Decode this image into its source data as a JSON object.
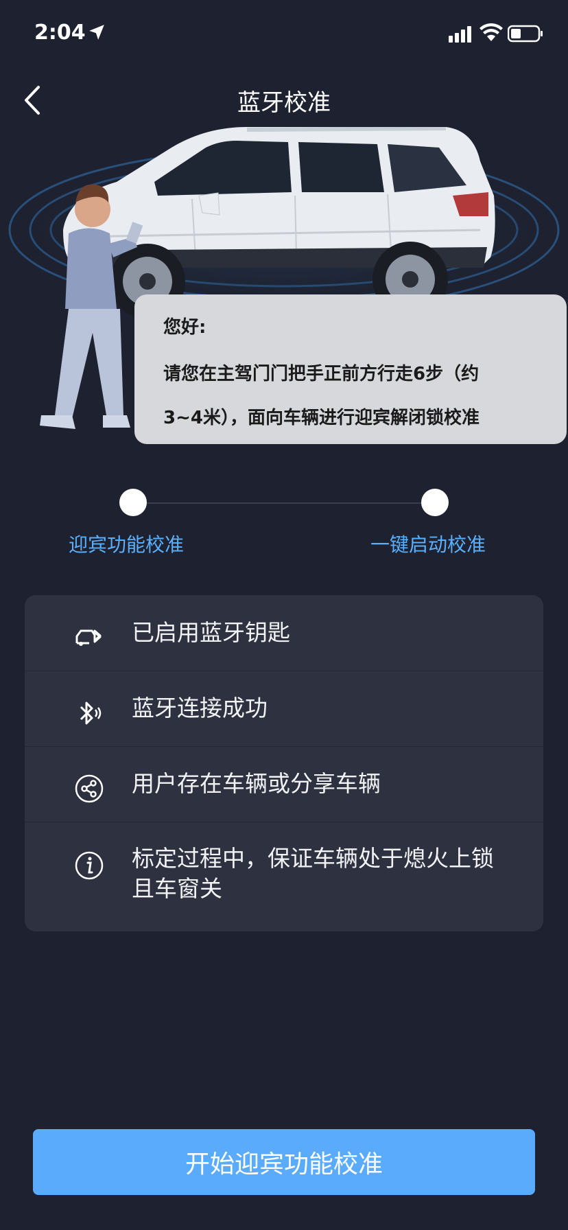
{
  "status_bar": {
    "time": "2:04"
  },
  "nav": {
    "title": "蓝牙校准"
  },
  "greeting": {
    "title": "您好:",
    "line1": "请您在主驾门门把手正前方行走6步（约",
    "line2": "3~4米），面向车辆进行迎宾解闭锁校准"
  },
  "steps": [
    {
      "label": "迎宾功能校准"
    },
    {
      "label": "一键启动校准"
    }
  ],
  "checklist": [
    {
      "icon": "car-bluetooth-key-icon",
      "text": "已启用蓝牙钥匙"
    },
    {
      "icon": "bluetooth-icon",
      "text": "蓝牙连接成功"
    },
    {
      "icon": "share-icon",
      "text": "用户存在车辆或分享车辆"
    },
    {
      "icon": "info-icon",
      "text": "标定过程中，保证车辆处于熄火上锁且车窗关"
    }
  ],
  "actions": {
    "start_label": "开始迎宾功能校准"
  },
  "colors": {
    "background": "#1e2230",
    "accent": "#5ab0ff",
    "button": "#5aabfc",
    "card": "#2d3140"
  }
}
